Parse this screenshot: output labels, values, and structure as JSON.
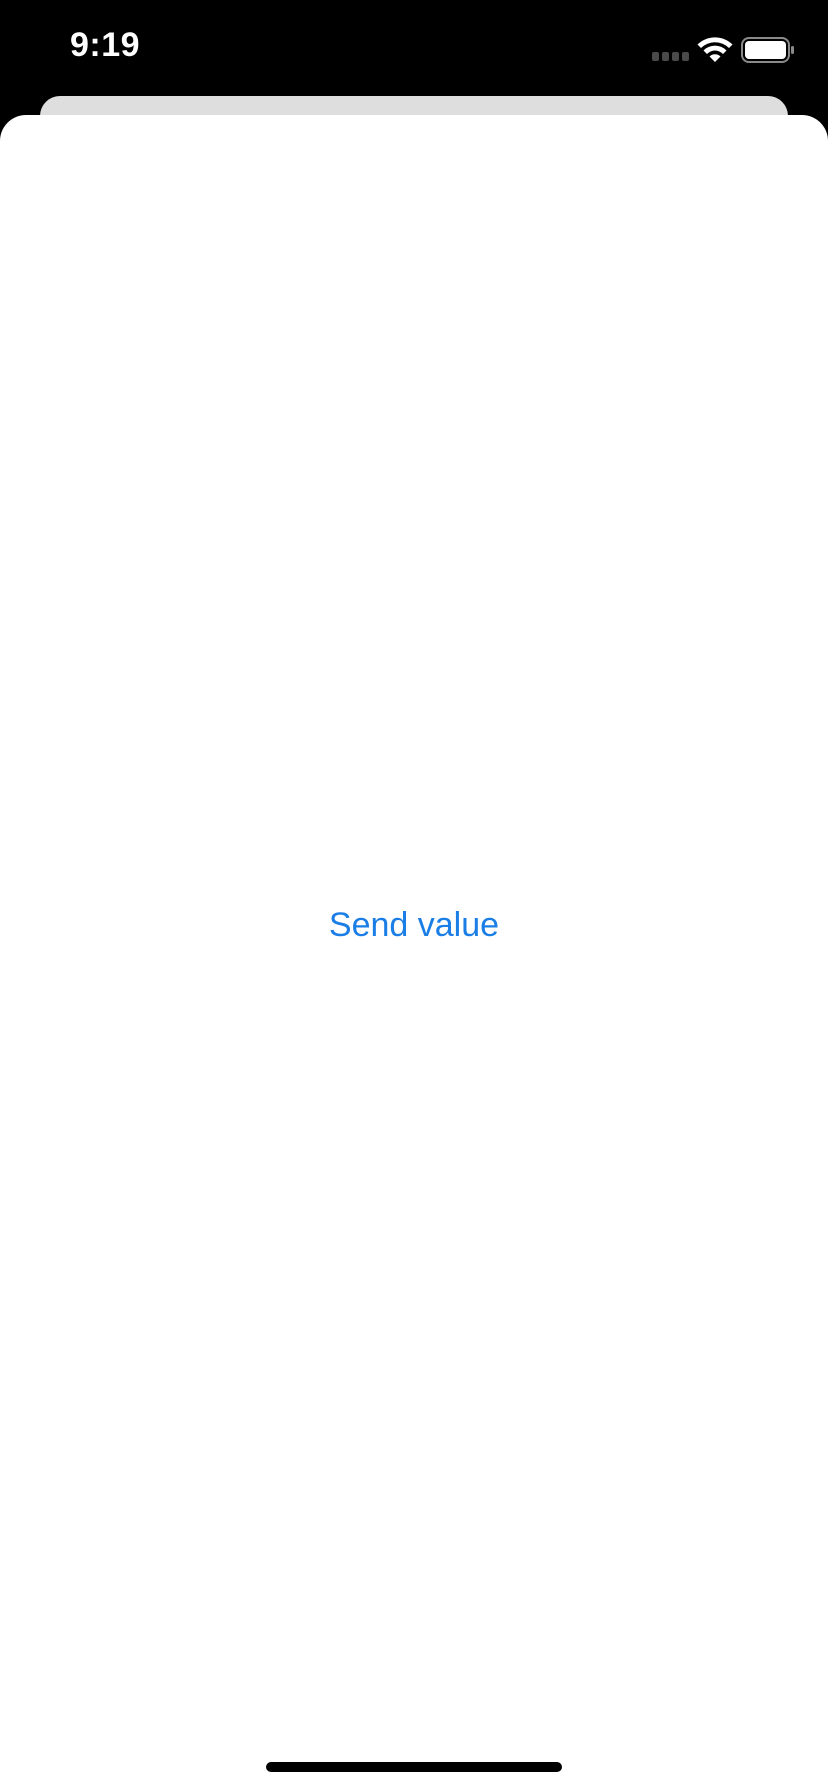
{
  "status_bar": {
    "time": "9:19",
    "icons": [
      "cellular-signal-icon",
      "wifi-icon",
      "battery-icon"
    ],
    "battery_level": 1.0
  },
  "sheet": {
    "button_label": "Send value"
  },
  "colors": {
    "accent": "#1a7ee6",
    "background": "#ffffff",
    "status_bar_background": "#000000",
    "back_card": "#dedede"
  }
}
